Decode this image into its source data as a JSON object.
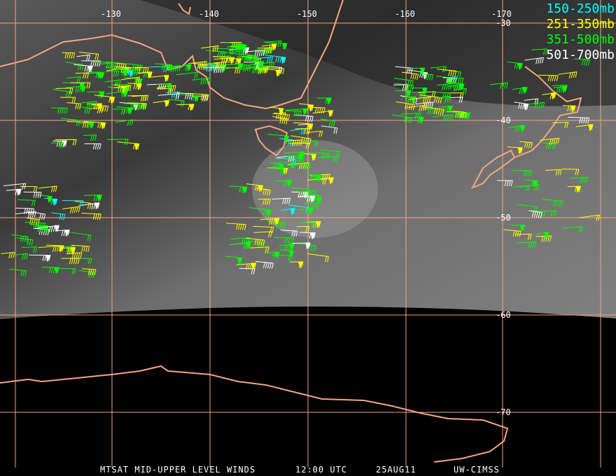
{
  "map": {
    "longitude_labels": [
      "-130",
      "-140",
      "-150",
      "-160",
      "-170"
    ],
    "latitude_labels": [
      "-30",
      "-40",
      "-50",
      "-60",
      "-70"
    ]
  },
  "legend": [
    {
      "label": "150-250mb",
      "color": "#00ffff"
    },
    {
      "label": "251-350mb",
      "color": "#ffff00"
    },
    {
      "label": "351-500mb",
      "color": "#00ff00"
    },
    {
      "label": "501-700mb",
      "color": "#ffffff"
    }
  ],
  "caption": {
    "product": "MTSAT MID-UPPER LEVEL WINDS",
    "time": "12:00 UTC",
    "date": "25AUG11",
    "source": "UW-CIMSS"
  },
  "colors": {
    "grid": "#f4a582",
    "coast": "#f4a582"
  }
}
